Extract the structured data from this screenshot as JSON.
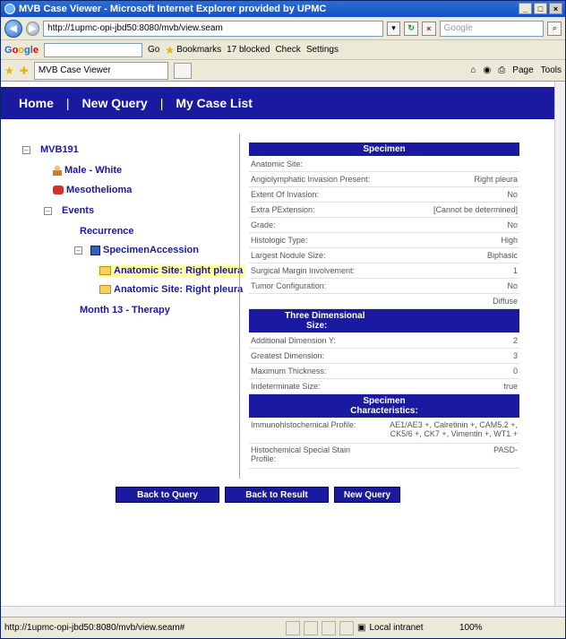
{
  "window": {
    "title": "MVB Case Viewer - Microsoft Internet Explorer provided by UPMC"
  },
  "address": {
    "url": "http://1upmc-opi-jbd50:8080/mvb/view.seam",
    "search_placeholder": "Google"
  },
  "googlebar": {
    "go_label": "Go",
    "bookmarks": "Bookmarks",
    "blocked": "17 blocked",
    "check": "Check",
    "settings": "Settings"
  },
  "tabbar": {
    "tab_title": "MVB Case Viewer",
    "page": "Page",
    "tools": "Tools"
  },
  "nav": {
    "home": "Home",
    "new_query": "New Query",
    "my_case_list": "My Case List",
    "sep": "|"
  },
  "tree": {
    "case_id": "MVB191",
    "patient": "Male - White",
    "diagnosis": "Mesothelioma",
    "events": "Events",
    "recurrence": "Recurrence",
    "specimen_accession": "SpecimenAccession",
    "site1": "Anatomic Site: Right pleura",
    "site2": "Anatomic Site: Right pleura",
    "therapy": "Month 13 - Therapy",
    "toggle_minus": "⊟"
  },
  "detail": {
    "specimen_header": "Specimen",
    "specimen_rows": [
      {
        "k": "Anatomic Site:",
        "v": ""
      },
      {
        "k": "Angiolymphatic Invasion Present:",
        "v": "Right pleura"
      },
      {
        "k": "Extent Of Invasion:",
        "v": "No"
      },
      {
        "k": "Extra PExtension:",
        "v": "[Cannot be determined]"
      },
      {
        "k": "Grade:",
        "v": "No"
      },
      {
        "k": "Histologic Type:",
        "v": "High"
      },
      {
        "k": "Largest Nodule Size:",
        "v": "Biphasic"
      },
      {
        "k": "Surgical Margin Involvement:",
        "v": "1"
      },
      {
        "k": "Tumor Configuration:",
        "v": "No"
      },
      {
        "k": "",
        "v": "Diffuse"
      }
    ],
    "three_header_line1": "Three Dimensional",
    "three_header_line2": "Size:",
    "three_rows": [
      {
        "k": "Additional Dimension Y:",
        "v": "2"
      },
      {
        "k": "Greatest Dimension:",
        "v": "3"
      },
      {
        "k": "Maximum Thickness:",
        "v": "0"
      },
      {
        "k": "Indeterminate Size:",
        "v": "true"
      }
    ],
    "char_header_line1": "Specimen",
    "char_header_line2": "Characteristics:",
    "char_rows": [
      {
        "k": "Immunohistochemical Profile:",
        "v": "AE1/AE3 +, Calretinin +, CAM5.2 +, CK5/6 +, CK7 +, Vimentin +, WT1 +"
      },
      {
        "k": "Histochemical Special Stain Profile:",
        "v": "PASD-"
      }
    ]
  },
  "buttons": {
    "back_query": "Back to Query",
    "back_result": "Back to Result",
    "new_query": "New Query"
  },
  "status": {
    "url": "http://1upmc-opi-jbd50:8080/mvb/view.seam#",
    "zone": "Local intranet",
    "zoom": "100%"
  }
}
